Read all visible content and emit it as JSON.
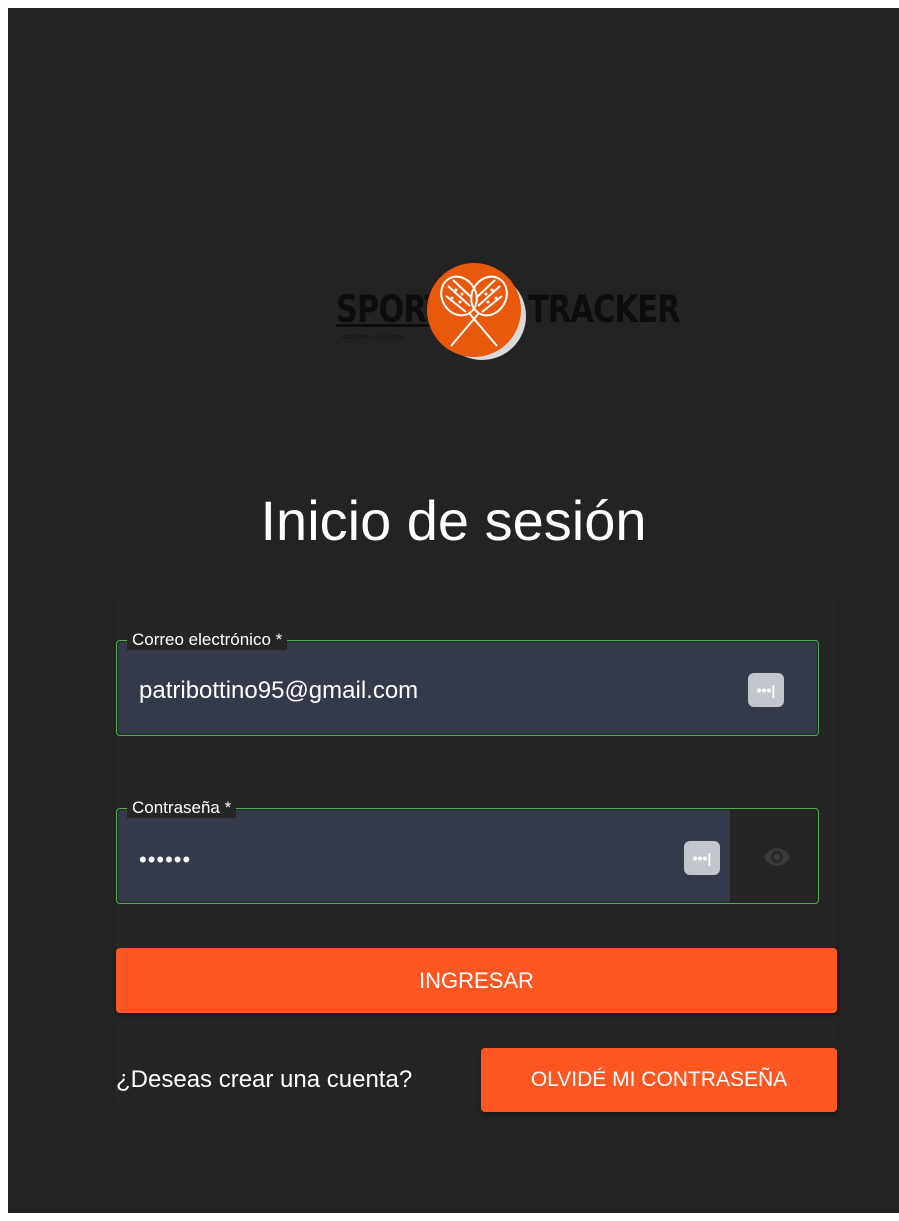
{
  "brand": {
    "left_word": "SPORT",
    "right_word": "TRACKER",
    "tagline": "REGISTRA TUS LOGROS",
    "accent_color": "#e8590c"
  },
  "page": {
    "title": "Inicio de sesión"
  },
  "form": {
    "email": {
      "label": "Correo electrónico *",
      "value": "patribottino95@gmail.com",
      "autofill_icon": "password-autofill-icon"
    },
    "password": {
      "label": "Contraseña *",
      "value": "••••••",
      "autofill_icon": "password-autofill-icon",
      "toggle_icon": "eye-icon"
    },
    "submit_label": "INGRESAR"
  },
  "footer": {
    "create_account_label": "¿Deseas crear una cuenta?",
    "forgot_password_label": "OLVIDÉ MI CONTRASEÑA"
  },
  "colors": {
    "background": "#232323",
    "primary_button": "#ff5722",
    "input_fill": "#343a4a",
    "input_border": "#4caf50"
  }
}
